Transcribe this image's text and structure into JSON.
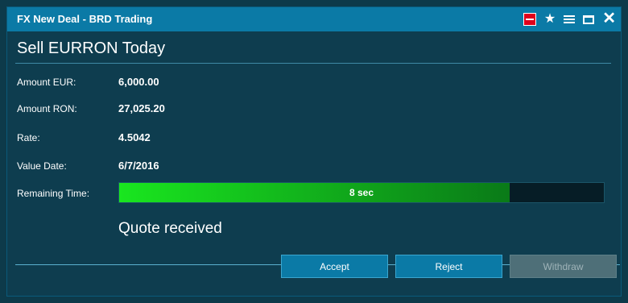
{
  "window": {
    "title": "FX New Deal - BRD Trading"
  },
  "titlebar_icons": [
    "brand-icon",
    "star-icon",
    "menu-icon",
    "maximize-icon",
    "close-icon"
  ],
  "heading": "Sell EURRON Today",
  "fields": [
    {
      "label": "Amount EUR:",
      "value": "6,000.00"
    },
    {
      "label": "Amount RON:",
      "value": "27,025.20"
    },
    {
      "label": "Rate:",
      "value": "4.5042"
    },
    {
      "label": "Value Date:",
      "value": "6/7/2016"
    }
  ],
  "remaining": {
    "label": "Remaining Time:",
    "text": "8 sec",
    "fraction": 0.805
  },
  "status": "Quote received",
  "buttons": {
    "accept": "Accept",
    "reject": "Reject",
    "withdraw": "Withdraw"
  },
  "colors": {
    "titlebar": "#0b7aa6",
    "background": "#0e3d4f",
    "progress_start": "#19e61f",
    "progress_end": "#0a7a18",
    "brand": "#e0001b"
  }
}
